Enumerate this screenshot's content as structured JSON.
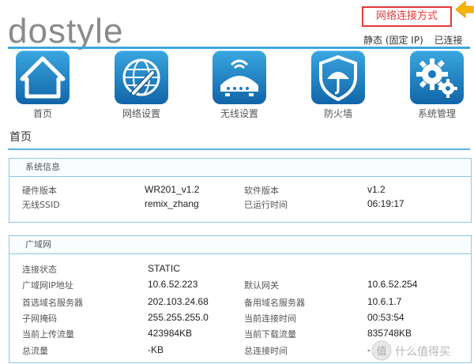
{
  "brand": {
    "logo_text": "dostyle"
  },
  "annotation": {
    "label": "网络连接方式"
  },
  "connection": {
    "mode": "静态 (固定 IP)",
    "status": "已连接"
  },
  "nav": [
    {
      "label": "首页",
      "icon": "home-icon"
    },
    {
      "label": "网络设置",
      "icon": "globe-wrench-icon"
    },
    {
      "label": "无线设置",
      "icon": "wireless-router-icon"
    },
    {
      "label": "防火墙",
      "icon": "shield-umbrella-icon"
    },
    {
      "label": "系统管理",
      "icon": "gears-icon"
    }
  ],
  "page_title": "首页",
  "system_info": {
    "title": "系统信息",
    "hw_label": "硬件版本",
    "hw_value": "WR201_v1.2",
    "sw_label": "软件版本",
    "sw_value": "v1.2",
    "ssid_label": "无线SSID",
    "ssid_value": "remix_zhang",
    "uptime_label": "已运行时间",
    "uptime_value": "06:19:17"
  },
  "wan": {
    "title": "广域网",
    "status_label": "连接状态",
    "status_value": "STATIC",
    "ip_label": "广域网IP地址",
    "ip_value": "10.6.52.223",
    "gw_label": "默认网关",
    "gw_value": "10.6.52.254",
    "dns1_label": "首选域名服务器",
    "dns1_value": "202.103.24.68",
    "dns2_label": "备用域名服务器",
    "dns2_value": "10.6.1.7",
    "mask_label": "子网掩码",
    "mask_value": "255.255.255.0",
    "conn_time_label": "当前连接时间",
    "conn_time_value": "00:53:54",
    "up_label": "当前上传流量",
    "up_value": "423984KB",
    "down_label": "当前下载流量",
    "down_value": "835748KB",
    "total_label": "总流量",
    "total_value": "-KB",
    "total_time_label": "总连接时间",
    "total_time_value": "-"
  },
  "watermark": {
    "text": "什么值得买"
  },
  "colors": {
    "accent": "#3ca6dd",
    "tile_top": "#3aa6e0",
    "tile_bottom": "#1165a8",
    "annotation": "#e23a3a"
  }
}
